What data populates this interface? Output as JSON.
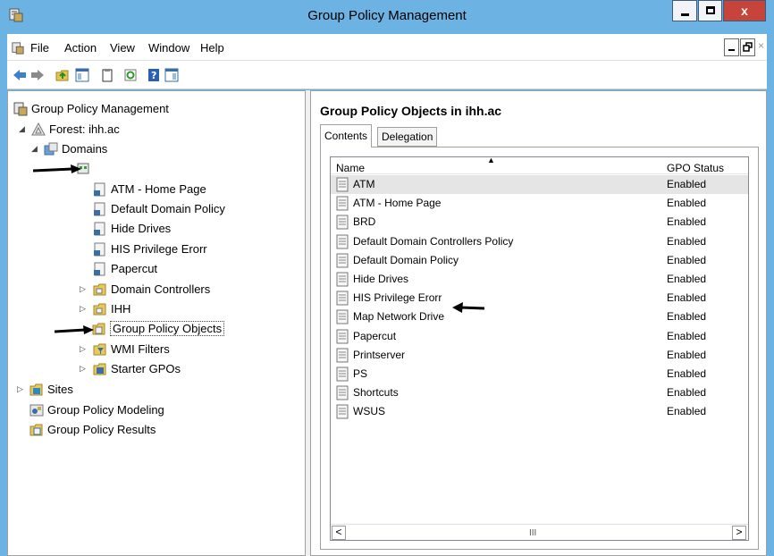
{
  "window": {
    "title": "Group Policy Management",
    "close_label": "x"
  },
  "menu": [
    "File",
    "Action",
    "View",
    "Window",
    "Help"
  ],
  "tree": {
    "root": "Group Policy Management",
    "forest": "Forest: ihh.ac",
    "domains": "Domains",
    "domain_node": "",
    "items": [
      "ATM - Home Page",
      "Default Domain Policy",
      "Hide Drives",
      "HIS Privilege Erorr",
      "Papercut",
      "Domain Controllers",
      "IHH",
      "Group Policy Objects",
      "WMI Filters",
      "Starter GPOs"
    ],
    "sites": "Sites",
    "modeling": "Group Policy Modeling",
    "results": "Group Policy Results"
  },
  "right": {
    "heading": "Group Policy Objects in ihh.ac",
    "tabs": [
      "Contents",
      "Delegation"
    ],
    "columns": [
      "Name",
      "GPO Status"
    ],
    "rows": [
      {
        "name": "ATM",
        "status": "Enabled"
      },
      {
        "name": "ATM - Home Page",
        "status": "Enabled"
      },
      {
        "name": "BRD",
        "status": "Enabled"
      },
      {
        "name": "Default Domain Controllers Policy",
        "status": "Enabled"
      },
      {
        "name": "Default Domain Policy",
        "status": "Enabled"
      },
      {
        "name": "Hide Drives",
        "status": "Enabled"
      },
      {
        "name": "HIS Privilege Erorr",
        "status": "Enabled"
      },
      {
        "name": "Map Network Drive",
        "status": "Enabled"
      },
      {
        "name": "Papercut",
        "status": "Enabled"
      },
      {
        "name": "Printserver",
        "status": "Enabled"
      },
      {
        "name": "PS",
        "status": "Enabled"
      },
      {
        "name": "Shortcuts",
        "status": "Enabled"
      },
      {
        "name": "WSUS",
        "status": "Enabled"
      }
    ],
    "scroll_thumb": "III",
    "scroll_left": "<",
    "scroll_right": ">"
  },
  "colors": {
    "titlebar": "#6cb2e3",
    "close": "#c7443a",
    "row_highlight": "#e5e5e5"
  }
}
